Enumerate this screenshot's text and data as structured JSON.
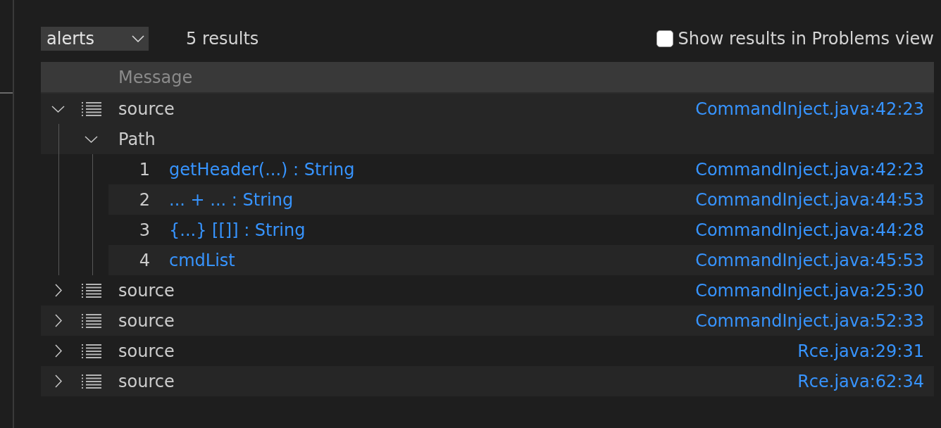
{
  "toolbar": {
    "result_set": "alerts",
    "result_count": "5 results",
    "problems_view": {
      "label": "Show results in Problems view",
      "checked": false
    }
  },
  "table": {
    "columns": [
      "Message"
    ],
    "alerts": [
      {
        "message": "source",
        "location": "CommandInject.java:42:23",
        "expanded": true,
        "children": [
          {
            "label": "Path",
            "expanded": true,
            "children": [
              {
                "number": "1",
                "text": "getHeader(...) : String",
                "location": "CommandInject.java:42:23"
              },
              {
                "number": "2",
                "text": "... + ... : String",
                "location": "CommandInject.java:44:53"
              },
              {
                "number": "3",
                "text": "{...} [[]] : String",
                "location": "CommandInject.java:44:28"
              },
              {
                "number": "4",
                "text": "cmdList",
                "location": "CommandInject.java:45:53"
              }
            ]
          }
        ]
      },
      {
        "message": "source",
        "location": "CommandInject.java:25:30",
        "expanded": false
      },
      {
        "message": "source",
        "location": "CommandInject.java:52:33",
        "expanded": false
      },
      {
        "message": "source",
        "location": "Rce.java:29:31",
        "expanded": false
      },
      {
        "message": "source",
        "location": "Rce.java:62:34",
        "expanded": false
      }
    ]
  }
}
